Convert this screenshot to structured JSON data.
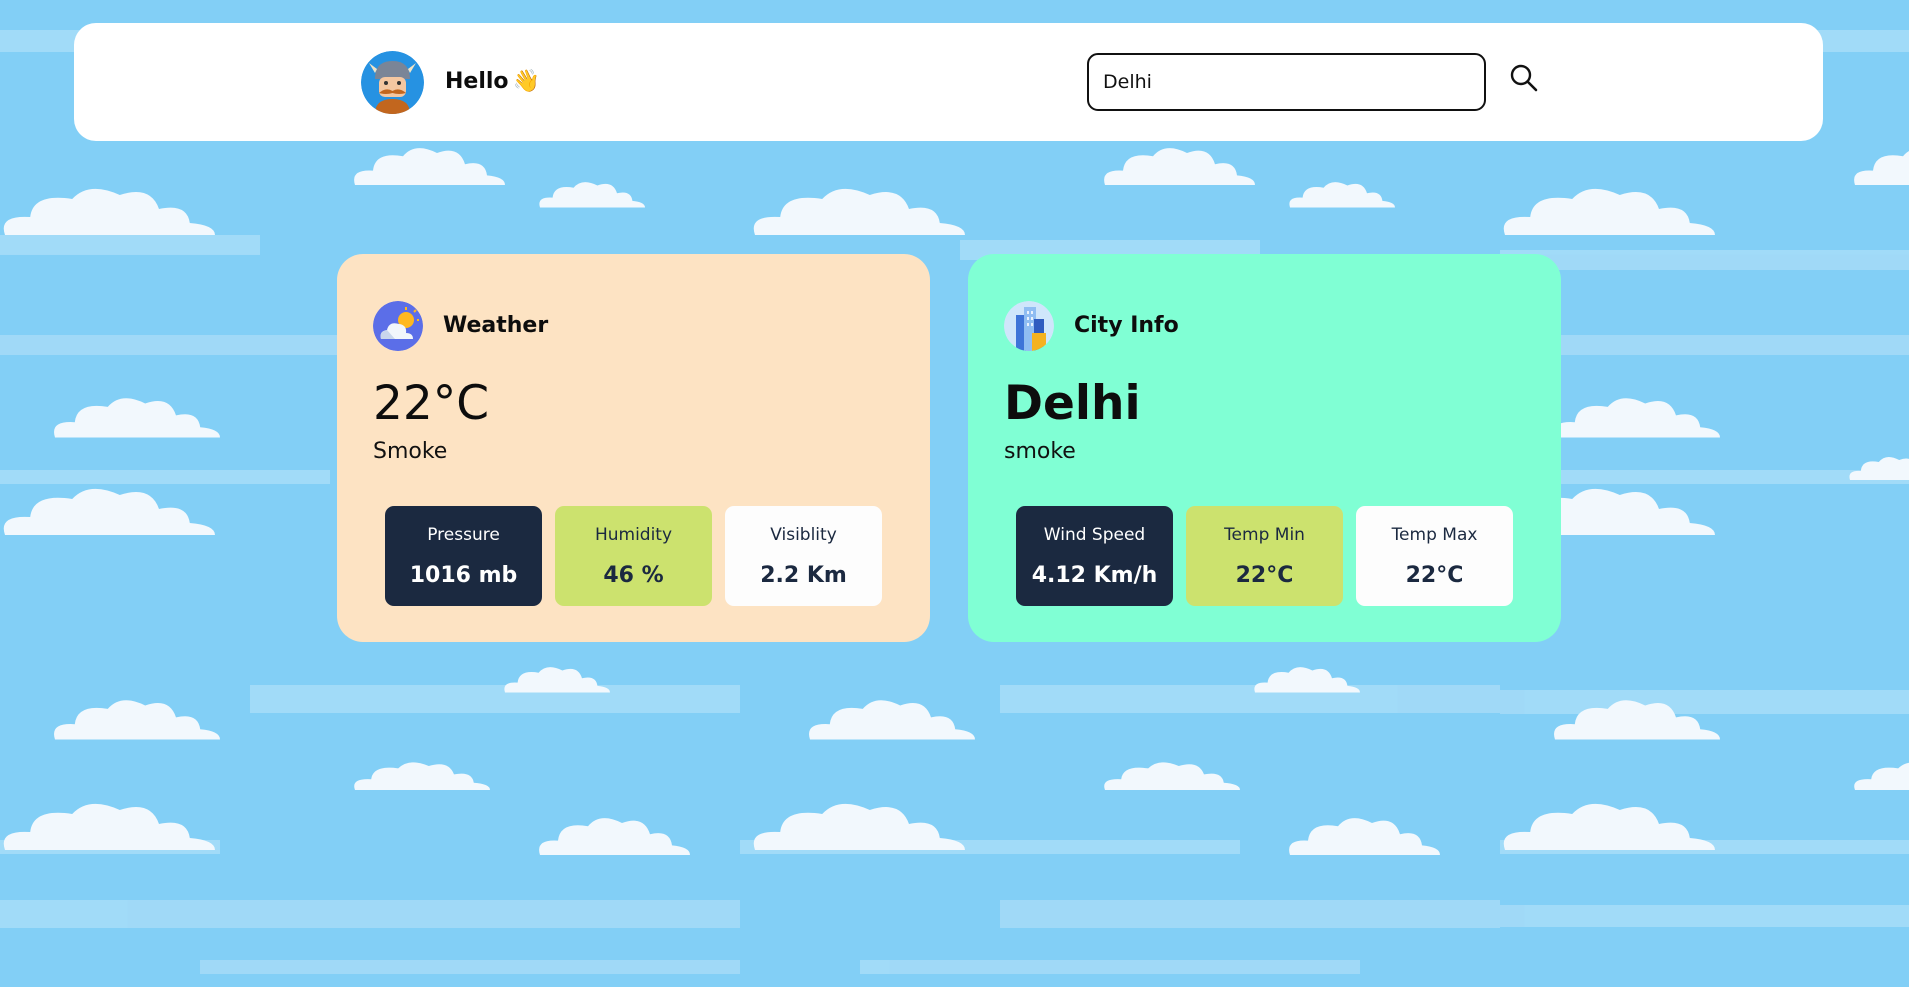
{
  "header": {
    "greeting": "Hello",
    "wave_emoji": "👋",
    "avatar_icon": "viking-avatar-icon",
    "search": {
      "value": "Delhi",
      "placeholder": "",
      "icon": "search-icon"
    }
  },
  "weather_card": {
    "title": "Weather",
    "icon": "cloud-sun-icon",
    "temperature": "22°C",
    "condition": "Smoke",
    "background": "#fde3c3",
    "tiles": [
      {
        "label": "Pressure",
        "value": "1016 mb"
      },
      {
        "label": "Humidity",
        "value": "46 %"
      },
      {
        "label": "Visiblity",
        "value": "2.2 Km"
      }
    ]
  },
  "city_card": {
    "title": "City Info",
    "icon": "city-buildings-icon",
    "city": "Delhi",
    "description": "smoke",
    "background": "#80ffd4",
    "tiles": [
      {
        "label": "Wind Speed",
        "value": "4.12 Km/h"
      },
      {
        "label": "Temp Min",
        "value": "22°C"
      },
      {
        "label": "Temp Max",
        "value": "22°C"
      }
    ]
  },
  "colors": {
    "sky": "#82cff6",
    "tile_dark": "#1b2940",
    "tile_green": "#cce26e",
    "tile_white": "#fdfdfd"
  }
}
